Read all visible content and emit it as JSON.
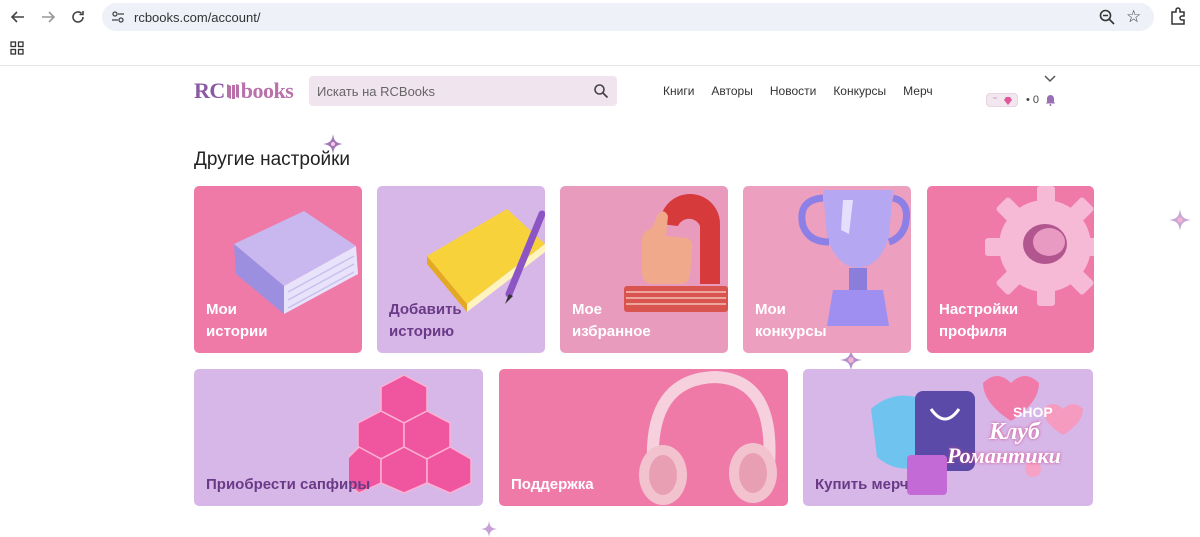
{
  "browser": {
    "url": "rcbooks.com/account/"
  },
  "header": {
    "logo_rc": "RC",
    "logo_books": "books",
    "search_placeholder": "Искать на RCBooks",
    "nav": [
      "Книги",
      "Авторы",
      "Новости",
      "Конкурсы",
      "Мерч"
    ],
    "notification_count": "• 0"
  },
  "section": {
    "title": "Другие настройки"
  },
  "cards_row1": [
    {
      "line1": "Мои",
      "line2": "истории",
      "bg": "#ef7aa8"
    },
    {
      "line1": "Добавить",
      "line2": "историю",
      "bg": "#d7b7e8"
    },
    {
      "line1": "Мое",
      "line2": "избранное",
      "bg": "#e99bbd"
    },
    {
      "line1": "Мои",
      "line2": "конкурсы",
      "bg": "#ec9fbf"
    },
    {
      "line1": "Настройки",
      "line2": "профиля",
      "bg": "#ef7aa8"
    }
  ],
  "cards_row2": [
    {
      "label": "Приобрести сапфиры",
      "bg": "#d7b7e8"
    },
    {
      "label": "Поддержка",
      "bg": "#ef7aa8"
    },
    {
      "label": "Купить мерч",
      "bg": "#d7b7e8"
    }
  ],
  "merch_art": {
    "shop": "SHOP",
    "title1": "Клуб",
    "title2": "Романтики"
  },
  "colors": {
    "pink": "#ef7aa8",
    "lilac": "#d7b7e8",
    "logo": "#8a5aa3"
  }
}
